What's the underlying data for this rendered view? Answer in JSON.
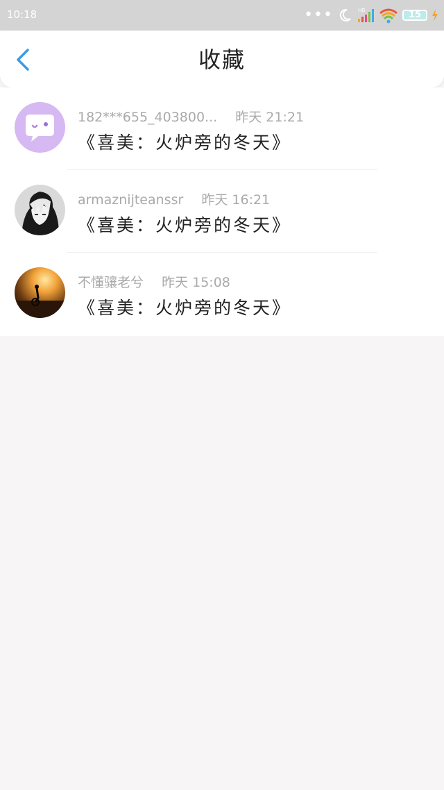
{
  "status_bar": {
    "time": "10:18",
    "battery": "15",
    "icons": [
      "more-dots-icon",
      "moon-icon",
      "signal-icon",
      "wifi-icon",
      "battery-icon",
      "charging-icon"
    ]
  },
  "header": {
    "title": "收藏",
    "back_icon": "chevron-left-icon",
    "accent_color": "#3a9be6"
  },
  "favorites": [
    {
      "user": "182***655_403800...",
      "date": "昨天",
      "time": "21:21",
      "title": "《喜美：火炉旁的冬天》",
      "avatar": "chat-bubble-avatar"
    },
    {
      "user": "armaznijteanssr",
      "date": "昨天",
      "time": "16:21",
      "title": "《喜美：火炉旁的冬天》",
      "avatar": "anime-character-avatar"
    },
    {
      "user": "不懂骧老兮",
      "date": "昨天",
      "time": "15:08",
      "title": "《喜美：火炉旁的冬天》",
      "avatar": "sunset-cyclist-avatar"
    }
  ]
}
